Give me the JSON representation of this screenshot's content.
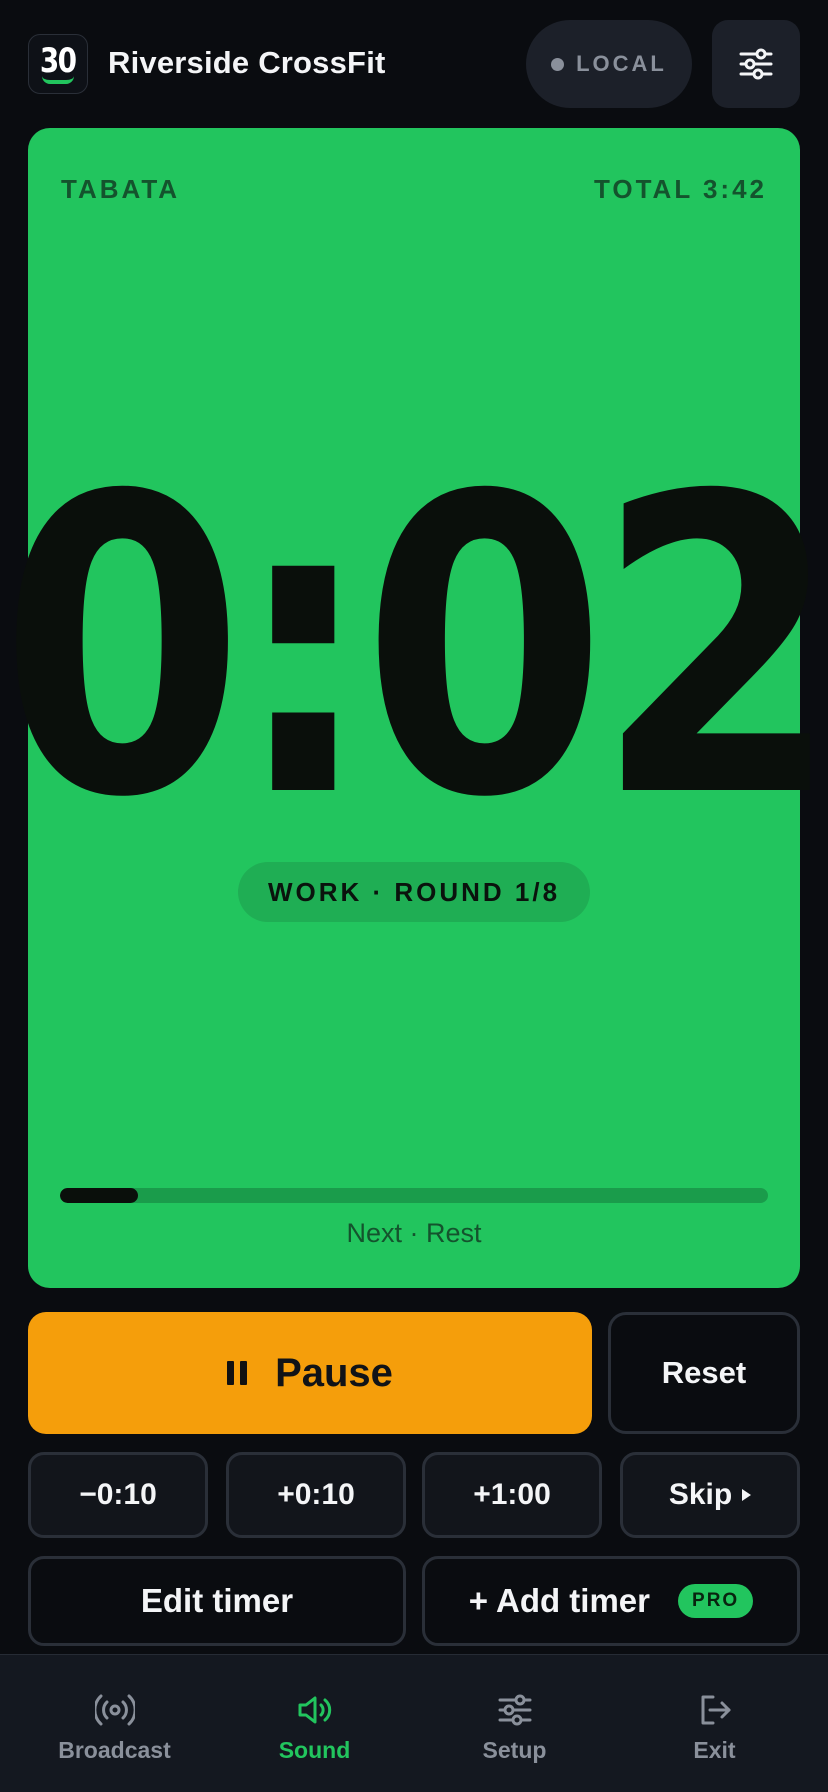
{
  "header": {
    "logo_text": "30",
    "gym_name": "Riverside CrossFit",
    "mode_pill": "LOCAL"
  },
  "timer": {
    "mode": "TABATA",
    "total": "TOTAL 3:42",
    "clock": "0:02",
    "phase": "WORK · ROUND 1/8",
    "progress_fraction": 0.11,
    "next": "Next · Rest"
  },
  "controls": {
    "pause_label": "Pause",
    "reset_label": "Reset",
    "adjust": [
      "−0:10",
      "+0:10",
      "+1:00"
    ],
    "skip_label": "Skip",
    "edit_label": "Edit timer",
    "add_label": "+ Add timer",
    "pro_badge": "PRO"
  },
  "nav": {
    "items": [
      {
        "label": "Broadcast",
        "icon": "broadcast-icon",
        "active": false
      },
      {
        "label": "Sound",
        "icon": "speaker-icon",
        "active": true
      },
      {
        "label": "Setup",
        "icon": "sliders-icon",
        "active": false
      },
      {
        "label": "Exit",
        "icon": "exit-icon",
        "active": false
      }
    ]
  },
  "colors": {
    "background": "#0a0c10",
    "work_green": "#22c55e",
    "pause_amber": "#f59e0b",
    "muted": "#8a909b"
  }
}
